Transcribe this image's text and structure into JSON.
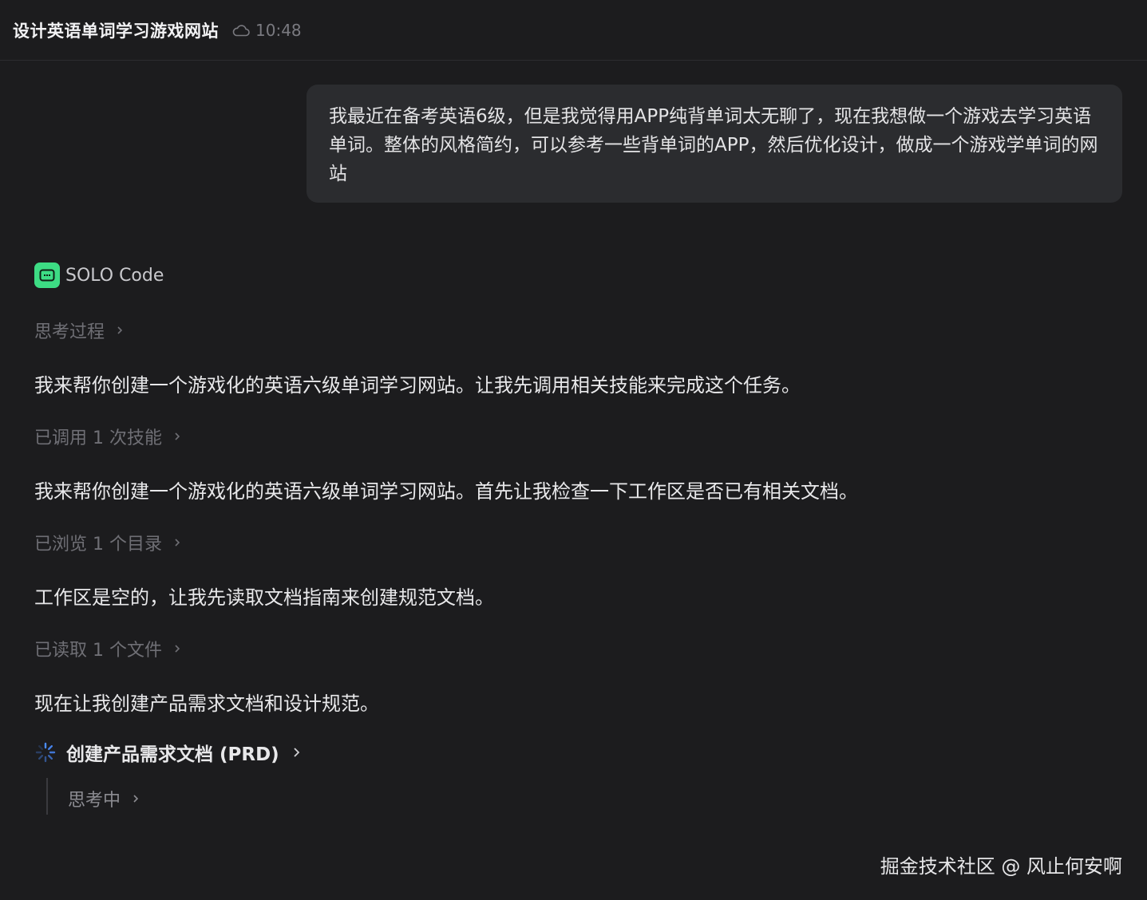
{
  "header": {
    "title": "设计英语单词学习游戏网站",
    "time": "10:48",
    "status_icon": "cloud-icon"
  },
  "user_message": {
    "text": "我最近在备考英语6级，但是我觉得用APP纯背单词太无聊了，现在我想做一个游戏去学习英语单词。整体的风格简约，可以参考一些背单词的APP，然后优化设计，做成一个游戏学单词的网站"
  },
  "agent": {
    "name": "SOLO Code",
    "logo_color": "#3ddc84",
    "thinking_label": "思考过程",
    "message_1": "我来帮你创建一个游戏化的英语六级单词学习网站。让我先调用相关技能来完成这个任务。",
    "step_skills": "已调用 1 次技能",
    "message_2": "我来帮你创建一个游戏化的英语六级单词学习网站。首先让我检查一下工作区是否已有相关文档。",
    "step_dir": "已浏览 1 个目录",
    "message_3": "工作区是空的，让我先读取文档指南来创建规范文档。",
    "step_file": "已读取 1 个文件",
    "message_4": "现在让我创建产品需求文档和设计规范。",
    "task_title": "创建产品需求文档 (PRD)",
    "task_substep": "思考中"
  },
  "watermark": "掘金技术社区 @ 风止何安啊"
}
